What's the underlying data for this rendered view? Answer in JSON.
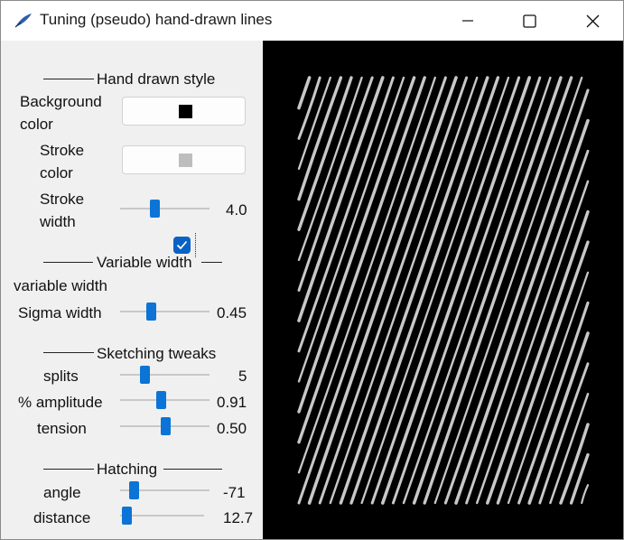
{
  "window": {
    "title": "Tuning (pseudo) hand-drawn lines",
    "icon": "feather-pen-icon",
    "controls": [
      "minimize-icon",
      "maximize-icon",
      "close-icon"
    ]
  },
  "sections": {
    "hand_drawn": "Hand drawn style",
    "variable_width": "Variable width",
    "sketching": "Sketching tweaks",
    "hatching": "Hatching"
  },
  "hand_drawn": {
    "background_color_label_1": "Background",
    "background_color_label_2": "color",
    "background_color": "#000000",
    "stroke_color_label_1": "Stroke",
    "stroke_color_label_2": "color",
    "stroke_color": "#bdbdbd",
    "stroke_width_label_1": "Stroke",
    "stroke_width_label_2": "width",
    "stroke_width_value": "4.0",
    "stroke_width_fraction": 0.38
  },
  "variable_width": {
    "checkbox_label": "variable width",
    "checked": true,
    "sigma_label": "Sigma width",
    "sigma_value": "0.45",
    "sigma_fraction": 0.34
  },
  "sketching": {
    "splits_label": "splits",
    "splits_value": "5",
    "splits_fraction": 0.27,
    "amplitude_label": "% amplitude",
    "amplitude_value": "0.91",
    "amplitude_fraction": 0.45,
    "tension_label": "tension",
    "tension_value": "0.50",
    "tension_fraction": 0.5
  },
  "hatching": {
    "angle_label": "angle",
    "angle_value": "-71",
    "angle_fraction": 0.15,
    "distance_label": "distance",
    "distance_value": "12.7",
    "distance_fraction": 0.07
  },
  "canvas": {
    "background": "#000000",
    "hatch_color": "#c8c8c8"
  }
}
